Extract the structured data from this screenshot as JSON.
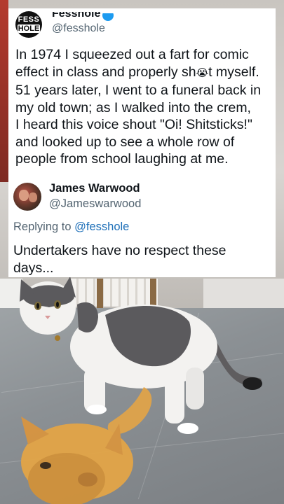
{
  "original_tweet": {
    "avatar_line1": "FESS",
    "avatar_line2": "HOLE",
    "display_name": "Fesshole",
    "handle": "@fesshole",
    "text": "In 1974 I squeezed out a fart for comic\neffect in class and properly sh",
    "emoji_glyph": "😭",
    "text_after_emoji": "t myself.\n51 years later, I went to a funeral back in\nmy old town; as I walked into the crem,\nI heard this voice shout \"Oi! Shitsticks!\"\nand looked up to see a whole row of\npeople from school laughing at me."
  },
  "reply": {
    "display_name": "James Warwood",
    "handle": "@Jameswarwood",
    "replying_to_prefix": "Replying to ",
    "replying_to_handle": "@fesshole",
    "text": "Undertakers have no respect these\ndays..."
  },
  "colors": {
    "verified_badge": "#1d9bf0",
    "link": "#1d6fb8",
    "secondary_text": "#536471"
  }
}
